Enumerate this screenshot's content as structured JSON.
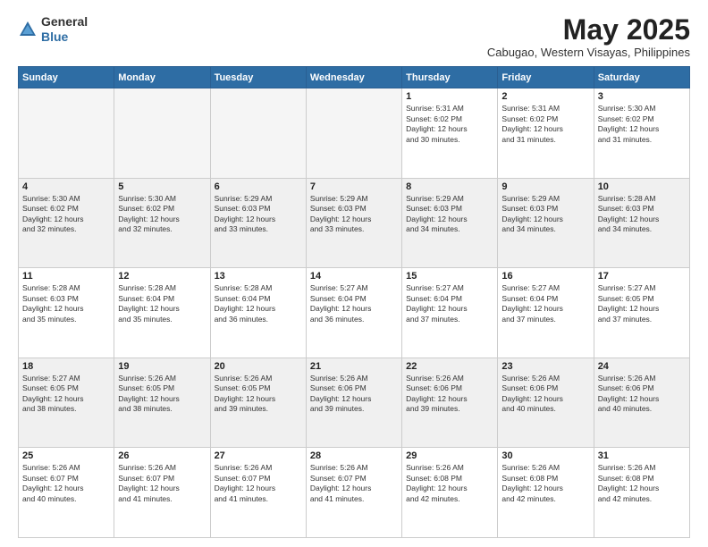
{
  "header": {
    "logo_general": "General",
    "logo_blue": "Blue",
    "month_title": "May 2025",
    "location": "Cabugao, Western Visayas, Philippines"
  },
  "weekdays": [
    "Sunday",
    "Monday",
    "Tuesday",
    "Wednesday",
    "Thursday",
    "Friday",
    "Saturday"
  ],
  "weeks": [
    [
      {
        "day": "",
        "info": ""
      },
      {
        "day": "",
        "info": ""
      },
      {
        "day": "",
        "info": ""
      },
      {
        "day": "",
        "info": ""
      },
      {
        "day": "1",
        "info": "Sunrise: 5:31 AM\nSunset: 6:02 PM\nDaylight: 12 hours\nand 30 minutes."
      },
      {
        "day": "2",
        "info": "Sunrise: 5:31 AM\nSunset: 6:02 PM\nDaylight: 12 hours\nand 31 minutes."
      },
      {
        "day": "3",
        "info": "Sunrise: 5:30 AM\nSunset: 6:02 PM\nDaylight: 12 hours\nand 31 minutes."
      }
    ],
    [
      {
        "day": "4",
        "info": "Sunrise: 5:30 AM\nSunset: 6:02 PM\nDaylight: 12 hours\nand 32 minutes."
      },
      {
        "day": "5",
        "info": "Sunrise: 5:30 AM\nSunset: 6:02 PM\nDaylight: 12 hours\nand 32 minutes."
      },
      {
        "day": "6",
        "info": "Sunrise: 5:29 AM\nSunset: 6:03 PM\nDaylight: 12 hours\nand 33 minutes."
      },
      {
        "day": "7",
        "info": "Sunrise: 5:29 AM\nSunset: 6:03 PM\nDaylight: 12 hours\nand 33 minutes."
      },
      {
        "day": "8",
        "info": "Sunrise: 5:29 AM\nSunset: 6:03 PM\nDaylight: 12 hours\nand 34 minutes."
      },
      {
        "day": "9",
        "info": "Sunrise: 5:29 AM\nSunset: 6:03 PM\nDaylight: 12 hours\nand 34 minutes."
      },
      {
        "day": "10",
        "info": "Sunrise: 5:28 AM\nSunset: 6:03 PM\nDaylight: 12 hours\nand 34 minutes."
      }
    ],
    [
      {
        "day": "11",
        "info": "Sunrise: 5:28 AM\nSunset: 6:03 PM\nDaylight: 12 hours\nand 35 minutes."
      },
      {
        "day": "12",
        "info": "Sunrise: 5:28 AM\nSunset: 6:04 PM\nDaylight: 12 hours\nand 35 minutes."
      },
      {
        "day": "13",
        "info": "Sunrise: 5:28 AM\nSunset: 6:04 PM\nDaylight: 12 hours\nand 36 minutes."
      },
      {
        "day": "14",
        "info": "Sunrise: 5:27 AM\nSunset: 6:04 PM\nDaylight: 12 hours\nand 36 minutes."
      },
      {
        "day": "15",
        "info": "Sunrise: 5:27 AM\nSunset: 6:04 PM\nDaylight: 12 hours\nand 37 minutes."
      },
      {
        "day": "16",
        "info": "Sunrise: 5:27 AM\nSunset: 6:04 PM\nDaylight: 12 hours\nand 37 minutes."
      },
      {
        "day": "17",
        "info": "Sunrise: 5:27 AM\nSunset: 6:05 PM\nDaylight: 12 hours\nand 37 minutes."
      }
    ],
    [
      {
        "day": "18",
        "info": "Sunrise: 5:27 AM\nSunset: 6:05 PM\nDaylight: 12 hours\nand 38 minutes."
      },
      {
        "day": "19",
        "info": "Sunrise: 5:26 AM\nSunset: 6:05 PM\nDaylight: 12 hours\nand 38 minutes."
      },
      {
        "day": "20",
        "info": "Sunrise: 5:26 AM\nSunset: 6:05 PM\nDaylight: 12 hours\nand 39 minutes."
      },
      {
        "day": "21",
        "info": "Sunrise: 5:26 AM\nSunset: 6:06 PM\nDaylight: 12 hours\nand 39 minutes."
      },
      {
        "day": "22",
        "info": "Sunrise: 5:26 AM\nSunset: 6:06 PM\nDaylight: 12 hours\nand 39 minutes."
      },
      {
        "day": "23",
        "info": "Sunrise: 5:26 AM\nSunset: 6:06 PM\nDaylight: 12 hours\nand 40 minutes."
      },
      {
        "day": "24",
        "info": "Sunrise: 5:26 AM\nSunset: 6:06 PM\nDaylight: 12 hours\nand 40 minutes."
      }
    ],
    [
      {
        "day": "25",
        "info": "Sunrise: 5:26 AM\nSunset: 6:07 PM\nDaylight: 12 hours\nand 40 minutes."
      },
      {
        "day": "26",
        "info": "Sunrise: 5:26 AM\nSunset: 6:07 PM\nDaylight: 12 hours\nand 41 minutes."
      },
      {
        "day": "27",
        "info": "Sunrise: 5:26 AM\nSunset: 6:07 PM\nDaylight: 12 hours\nand 41 minutes."
      },
      {
        "day": "28",
        "info": "Sunrise: 5:26 AM\nSunset: 6:07 PM\nDaylight: 12 hours\nand 41 minutes."
      },
      {
        "day": "29",
        "info": "Sunrise: 5:26 AM\nSunset: 6:08 PM\nDaylight: 12 hours\nand 42 minutes."
      },
      {
        "day": "30",
        "info": "Sunrise: 5:26 AM\nSunset: 6:08 PM\nDaylight: 12 hours\nand 42 minutes."
      },
      {
        "day": "31",
        "info": "Sunrise: 5:26 AM\nSunset: 6:08 PM\nDaylight: 12 hours\nand 42 minutes."
      }
    ]
  ]
}
